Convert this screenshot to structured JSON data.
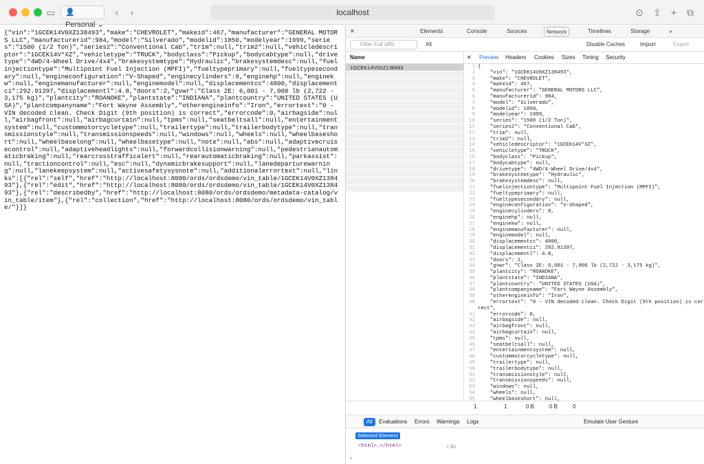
{
  "browser": {
    "profile": "Personal",
    "url": "localhost"
  },
  "page_text": "{\"vin\":\"1GCEK14V0XZ138493\",\"make\":\"CHEVROLET\",\"makeid\":467,\"manufacturer\":\"GENERAL MOTORS LLC\",\"manufacturerid\":984,\"model\":\"Silverado\",\"modelid\":1850,\"modelyear\":1999,\"series\":\"1500 (1/2 Ton)\",\"series2\":\"Conventional Cab\",\"trim\":null,\"trim2\":null,\"vehicledescriptor\":\"1GCEK14V*XZ\",\"vehicletype\":\"TRUCK\",\"bodyclass\":\"Pickup\",\"bodycabtype\":null,\"drivetype\":\"4WD/4-Wheel Drive/4x4\",\"brakesystemtype\":\"Hydraulic\",\"brakesystemdesc\":null,\"fuelinjectiontype\":\"Multipoint Fuel Injection (MPFI)\",\"fueltypeprimary\":null,\"fueltypesecondary\":null,\"engineconfiguration\":\"V-Shaped\",\"enginecylinders\":8,\"enginehp\":null,\"enginekw\":null,\"enginemanufacturer\":null,\"enginemodel\":null,\"displacementcc\":4800,\"displacementci\":292.91397,\"displacementl\":4.8,\"doors\":2,\"gvwr\":\"Class 2E: 6,001 - 7,000 lb (2,722 - 3,175 kg)\",\"plantcity\":\"ROANOKE\",\"plantstate\":\"INDIANA\",\"plantcountry\":\"UNITED STATES (USA)\",\"plantcompanyname\":\"Fort Wayne Assembly\",\"otherengineinfo\":\"Iron\",\"errortext\":\"0 - VIN decoded clean. Check Digit (9th position) is correct\",\"errorcode\":0,\"airbagside\":null,\"airbagfront\":null,\"airbagcurtain\":null,\"tpms\":null,\"seatbeltsall\":null,\"entertainmentsystem\":null,\"custommotorcycletype\":null,\"trailertype\":null,\"trailerbodytype\":null,\"transmissionstyle\":null,\"transmissionspeeds\":null,\"windows\":null,\"wheels\":null,\"wheelbaseshort\":null,\"wheelbaselong\":null,\"wheelbasetype\":null,\"note\":null,\"abs\":null,\"adaptivecruisecontrol\":null,\"adaptiveheadlights\":null,\"forwardcollisionwarning\":null,\"pedestrianautomaticbraking\":null,\"rearcrosstrafficalert\":null,\"rearautomaticbraking\":null,\"parkassist\":null,\"tractioncontrol\":null,\"esc\":null,\"dynamicbrakesupport\":null,\"lanedeparturewarning\":null,\"lanekeepsystem\":null,\"activesafetysysnote\":null,\"additionalerrortext\":null,\"links\":[{\"rel\":\"self\",\"href\":\"http://localhost:8080/ords/ordsdemo/vin_table/1GCEK14V0XZ138493\"},{\"rel\":\"edit\",\"href\":\"http://localhost:8080/ords/ordsdemo/vin_table/1GCEK14V0XZ138493\"},{\"rel\":\"describedby\",\"href\":\"http://localhost:8080/ords/ordsdemo/metadata-catalog/vin_table/item\"},{\"rel\":\"collection\",\"href\":\"http://localhost:8080/ords/ordsdemo/vin_table/\"}]}",
  "devtools": {
    "tabs": [
      "Elements",
      "Console",
      "Sources",
      "Network",
      "Timelines",
      "Storage"
    ],
    "selected_tab": "Network",
    "filter_placeholder": "Filter Full URL",
    "all_label": "All",
    "disable_caches": "Disable Caches",
    "import": "Import",
    "export": "Export",
    "name_header": "Name",
    "request_name": "1GCEK14V0XZ138493",
    "preview_tabs": [
      "Preview",
      "Headers",
      "Cookies",
      "Sizes",
      "Timing",
      "Security"
    ],
    "json_lines": [
      "{",
      "    \"vin\": \"1GCEK14V0XZ138493\",",
      "    \"make\": \"CHEVROLET\",",
      "    \"makeid\": 467,",
      "    \"manufacturer\": \"GENERAL MOTORS LLC\",",
      "    \"manufacturerid\": 984,",
      "    \"model\": \"Silverado\",",
      "    \"modelid\": 1850,",
      "    \"modelyear\": 1999,",
      "    \"series\": \"1500 (1/2 Ton)\",",
      "    \"series2\": \"Conventional Cab\",",
      "    \"trim\": null,",
      "    \"trim2\": null,",
      "    \"vehicledescriptor\": \"1GCEK14V*XZ\",",
      "    \"vehicletype\": \"TRUCK\",",
      "    \"bodyclass\": \"Pickup\",",
      "    \"bodycabtype\": null,",
      "    \"drivetype\": \"4WD/4-Wheel Drive/4x4\",",
      "    \"brakesystemtype\": \"Hydraulic\",",
      "    \"brakesystemdesc\": null,",
      "    \"fuelinjectiontype\": \"Multipoint Fuel Injection (MPFI)\",",
      "    \"fueltypeprimary\": null,",
      "    \"fueltypesecondary\": null,",
      "    \"engineconfiguration\": \"V-Shaped\",",
      "    \"enginecylinders\": 8,",
      "    \"enginehp\": null,",
      "    \"enginekw\": null,",
      "    \"enginemanufacturer\": null,",
      "    \"enginemodel\": null,",
      "    \"displacementcc\": 4800,",
      "    \"displacementci\": 292.91397,",
      "    \"displacementl\": 4.8,",
      "    \"doors\": 2,",
      "    \"gvwr\": \"Class 2E: 6,001 - 7,000 lb (2,722 - 3,175 kg)\",",
      "    \"plantcity\": \"ROANOKE\",",
      "    \"plantstate\": \"INDIANA\",",
      "    \"plantcountry\": \"UNITED STATES (USA)\",",
      "    \"plantcompanyname\": \"Fort Wayne Assembly\",",
      "    \"otherengineinfo\": \"Iron\",",
      "    \"errortext\": \"0 - VIN decoded clean. Check Digit (9th position) is correct\",",
      "    \"errorcode\": 0,",
      "    \"airbagside\": null,",
      "    \"airbagfront\": null,",
      "    \"airbagcurtain\": null,",
      "    \"tpms\": null,",
      "    \"seatbeltsall\": null,",
      "    \"entertainmentsystem\": null,",
      "    \"custommotorcycletype\": null,",
      "    \"trailertype\": null,",
      "    \"trailerbodytype\": null,",
      "    \"transmissionstyle\": null,",
      "    \"transmissionspeeds\": null,",
      "    \"windows\": null,",
      "    \"wheels\": null,",
      "    \"wheelbaseshort\": null,"
    ],
    "status": {
      "requests": "1",
      "resources": "1",
      "transferred": "0 B",
      "size": "0 B",
      "errors": "0"
    },
    "console_tabs": [
      "All",
      "Evaluations",
      "Errors",
      "Warnings",
      "Logs"
    ],
    "emulate_gesture": "Emulate User Gesture",
    "selected_element": "Selected Element",
    "html_node": "<html>…</html>",
    "dollar_ref": "= $1"
  }
}
